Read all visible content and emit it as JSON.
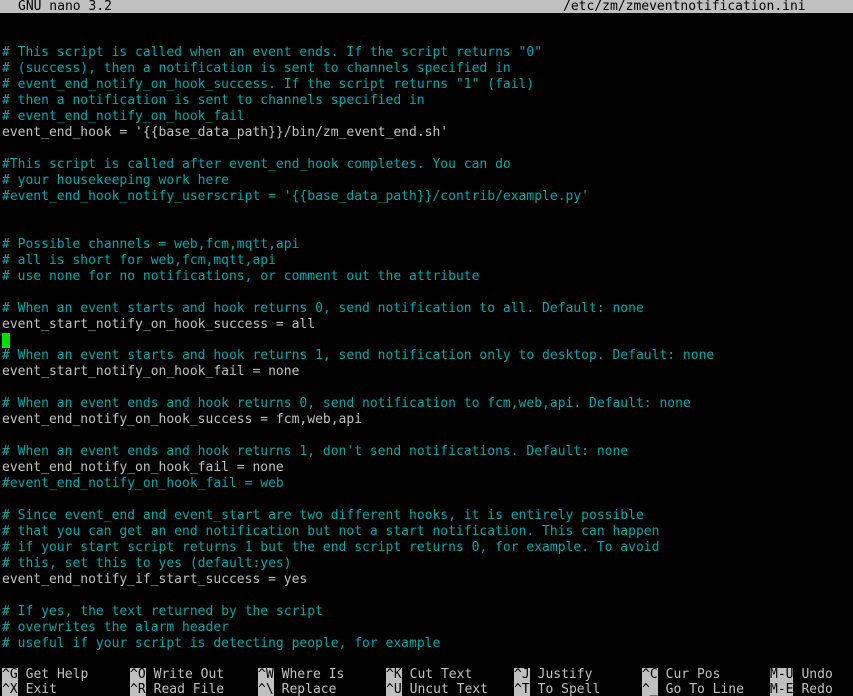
{
  "titlebar": {
    "app_name": "GNU nano 3.2",
    "file_path": "/etc/zm/zmeventnotification.ini"
  },
  "editor": {
    "lines": [
      {
        "text": "# This script is called when an event ends. If the script returns \"0\"",
        "kind": "comment"
      },
      {
        "text": "# (success), then a notification is sent to channels specified in",
        "kind": "comment"
      },
      {
        "text": "# event_end_notify_on_hook_success. If the script returns \"1\" (fail)",
        "kind": "comment"
      },
      {
        "text": "# then a notification is sent to channels specified in",
        "kind": "comment"
      },
      {
        "text": "# event_end_notify_on_hook_fail",
        "kind": "comment"
      },
      {
        "text": "event_end_hook = '{{base_data_path}}/bin/zm_event_end.sh'",
        "kind": "setting"
      },
      {
        "text": "",
        "kind": "blank"
      },
      {
        "text": "#This script is called after event_end_hook completes. You can do",
        "kind": "comment"
      },
      {
        "text": "# your housekeeping work here",
        "kind": "comment"
      },
      {
        "text": "#event_end_hook_notify_userscript = '{{base_data_path}}/contrib/example.py'",
        "kind": "comment"
      },
      {
        "text": "",
        "kind": "blank"
      },
      {
        "text": "",
        "kind": "blank"
      },
      {
        "text": "# Possible channels = web,fcm,mqtt,api",
        "kind": "comment"
      },
      {
        "text": "# all is short for web,fcm,mqtt,api",
        "kind": "comment"
      },
      {
        "text": "# use none for no notifications, or comment out the attribute",
        "kind": "comment"
      },
      {
        "text": "",
        "kind": "blank"
      },
      {
        "text": "# When an event starts and hook returns 0, send notification to all. Default: none",
        "kind": "comment"
      },
      {
        "text": "event_start_notify_on_hook_success = all",
        "kind": "setting"
      },
      {
        "text": "",
        "kind": "cursor"
      },
      {
        "text": "# When an event starts and hook returns 1, send notification only to desktop. Default: none",
        "kind": "comment"
      },
      {
        "text": "event_start_notify_on_hook_fail = none",
        "kind": "setting"
      },
      {
        "text": "",
        "kind": "blank"
      },
      {
        "text": "# When an event ends and hook returns 0, send notification to fcm,web,api. Default: none",
        "kind": "comment"
      },
      {
        "text": "event_end_notify_on_hook_success = fcm,web,api",
        "kind": "setting"
      },
      {
        "text": "",
        "kind": "blank"
      },
      {
        "text": "# When an event ends and hook returns 1, don't send notifications. Default: none",
        "kind": "comment"
      },
      {
        "text": "event_end_notify_on_hook_fail = none",
        "kind": "setting"
      },
      {
        "text": "#event_end_notify_on_hook_fail = web",
        "kind": "comment"
      },
      {
        "text": "",
        "kind": "blank"
      },
      {
        "text": "# Since event_end and event_start are two different hooks, it is entirely possible",
        "kind": "comment"
      },
      {
        "text": "# that you can get an end notification but not a start notification. This can happen",
        "kind": "comment"
      },
      {
        "text": "# if your start script returns 1 but the end script returns 0, for example. To avoid",
        "kind": "comment"
      },
      {
        "text": "# this, set this to yes (default:yes)",
        "kind": "comment"
      },
      {
        "text": "event_end_notify_if_start_success = yes",
        "kind": "setting"
      },
      {
        "text": "",
        "kind": "blank"
      },
      {
        "text": "# If yes, the text returned by the script",
        "kind": "comment"
      },
      {
        "text": "# overwrites the alarm header",
        "kind": "comment"
      },
      {
        "text": "# useful if your script is detecting people, for example",
        "kind": "comment"
      }
    ]
  },
  "shortcuts": [
    {
      "key": "^G",
      "label": "Get Help"
    },
    {
      "key": "^X",
      "label": "Exit"
    },
    {
      "key": "^O",
      "label": "Write Out"
    },
    {
      "key": "^R",
      "label": "Read File"
    },
    {
      "key": "^W",
      "label": "Where Is"
    },
    {
      "key": "^\\",
      "label": "Replace"
    },
    {
      "key": "^K",
      "label": "Cut Text"
    },
    {
      "key": "^U",
      "label": "Uncut Text"
    },
    {
      "key": "^J",
      "label": "Justify"
    },
    {
      "key": "^T",
      "label": "To Spell"
    },
    {
      "key": "^C",
      "label": "Cur Pos"
    },
    {
      "key": "^_",
      "label": "Go To Line"
    },
    {
      "key": "M-U",
      "label": "Undo"
    },
    {
      "key": "M-E",
      "label": "Redo"
    }
  ],
  "colors": {
    "background": "#000000",
    "comment": "#00a8a8",
    "text": "#c0c0c0",
    "cursor": "#00e000",
    "titlebar": "#c0c0c0"
  }
}
